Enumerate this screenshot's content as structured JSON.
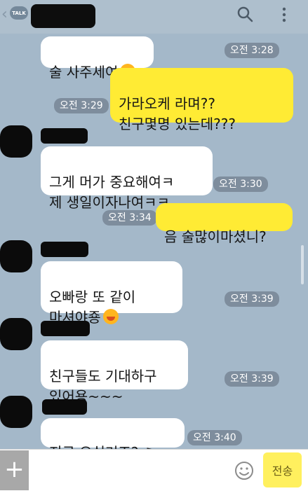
{
  "header": {
    "talk_badge": "TALK"
  },
  "messages": [
    {
      "side": "left",
      "text": "술 사주세여",
      "time": "오전 3:28",
      "emoji": "laughing-face"
    },
    {
      "side": "right",
      "text": "가라오케 라며??\n친구몇명 있는데???",
      "time": "오전 3:29"
    },
    {
      "side": "left",
      "text": "그게 머가 중요해여ㅋ\n제 생일이자나여ㅋㅋ",
      "time": "오전 3:30"
    },
    {
      "side": "right",
      "text": "음 술많이마셨니?",
      "time": "오전 3:34"
    },
    {
      "side": "left",
      "text": "오빠랑 또 같이\n마셔야죵",
      "time": "오전 3:39",
      "emoji": "shocked-face"
    },
    {
      "side": "left",
      "text": "친구들도 기대하구\n있어용~~~",
      "time": "오전 3:39"
    },
    {
      "side": "left",
      "text": "지금 오실거죠?",
      "time": "오전 3:40",
      "emoji": "music-note"
    }
  ],
  "input": {
    "send_label": "전송",
    "placeholder": ""
  },
  "icons": {
    "back": "back-chevron-icon",
    "search": "search-icon",
    "more": "more-icon",
    "plus": "plus-icon",
    "emoji": "emoji-icon",
    "music": "music-note-icon"
  },
  "colors": {
    "chat_background": "#a4b8c9",
    "my_bubble": "#ffeb34",
    "their_bubble": "#ffffff",
    "send_button": "#fff05e"
  }
}
